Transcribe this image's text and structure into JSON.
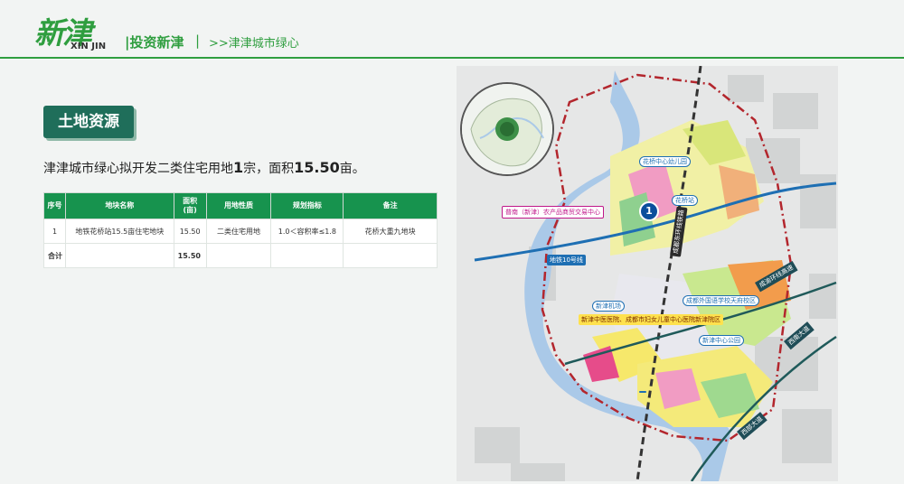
{
  "header": {
    "logo_cn": "新津",
    "logo_en": "XIN JIN",
    "section": "|投资新津",
    "separator": "|",
    "breadcrumb": ">>津津城市绿心"
  },
  "title_badge": "土地资源",
  "summary": {
    "pre": "津津城市绿心拟开发二类住宅用地",
    "count": "1",
    "mid": "宗，面积",
    "area": "15.50",
    "post": "亩。"
  },
  "table": {
    "headers": [
      "序号",
      "地块名称",
      "面积(亩)",
      "用地性质",
      "规划指标",
      "备注"
    ],
    "rows": [
      [
        "1",
        "地铁花桥站15.5亩住宅地块",
        "15.50",
        "二类住宅用地",
        "1.0＜容积率≤1.8",
        "花桥大重九地块"
      ]
    ],
    "total": [
      "合计",
      "",
      "15.50",
      "",
      "",
      ""
    ]
  },
  "map": {
    "labels": {
      "park_flower": "花桥中心幼儿园",
      "station": "花桥站",
      "market": "普南（新津）农产品商贸交易中心",
      "marker_num": "1",
      "metro": "地铁10号线",
      "rail": "成都东环线铁路",
      "airport": "新津机场",
      "school": "成都外国语学校天府校区",
      "hospital": "新津中医医院、成都市妇女儿童中心医院新津院区",
      "park_center": "新津中心公园",
      "park_baihe": "白鹤滩国家湿地公园",
      "expressway": "成渝环线高速",
      "road_w": "西南大道",
      "road_e": "西部大道"
    }
  },
  "colors": {
    "brand_green": "#2f9e3f",
    "badge": "#1f6e5a",
    "table_header": "#17934e"
  }
}
